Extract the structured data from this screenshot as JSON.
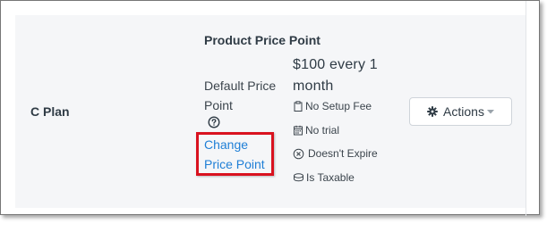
{
  "plan": {
    "name": "C Plan"
  },
  "price_point": {
    "section_title": "Product Price Point",
    "default_label": "Default Price Point",
    "change_link": "Change Price Point",
    "price_text": "$100 every 1 month",
    "attributes": [
      {
        "icon": "clipboard-icon",
        "label": "No Setup Fee"
      },
      {
        "icon": "calendar-icon",
        "label": "No trial"
      },
      {
        "icon": "circle-x-icon",
        "label": "Doesn't Expire"
      },
      {
        "icon": "coins-icon",
        "label": "Is Taxable"
      }
    ]
  },
  "actions": {
    "label": "Actions"
  },
  "colors": {
    "link": "#1f7fd6",
    "highlight": "#d9121f",
    "panel_bg": "#f5f6f8"
  }
}
